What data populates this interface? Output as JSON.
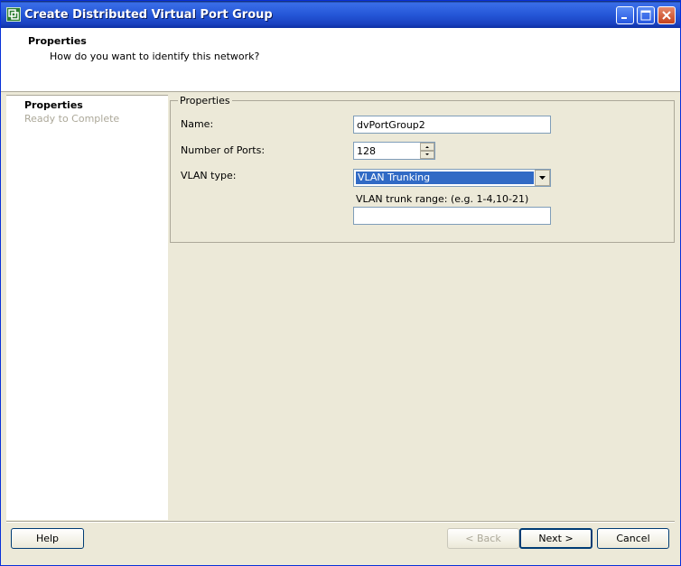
{
  "window": {
    "title": "Create Distributed Virtual Port Group"
  },
  "header": {
    "title": "Properties",
    "subtitle": "How do you want to identify this network?"
  },
  "steps": [
    {
      "label": "Properties",
      "state": "active"
    },
    {
      "label": "Ready to Complete",
      "state": "inactive"
    }
  ],
  "properties": {
    "legend": "Properties",
    "name_label": "Name:",
    "name_value": "dvPortGroup2",
    "ports_label": "Number of Ports:",
    "ports_value": "128",
    "vlan_label": "VLAN type:",
    "vlan_value": "VLAN Trunking",
    "trunk_label": "VLAN trunk range: (e.g. 1-4,10-21)",
    "trunk_value": ""
  },
  "buttons": {
    "help": "Help",
    "back": "< Back",
    "next": "Next >",
    "cancel": "Cancel"
  },
  "colors": {
    "titlebar": "#2557d8",
    "selection": "#316ac5",
    "dialog_bg": "#ece9d8"
  },
  "icons": {
    "app": "vmware-icon",
    "minimize": "minimize-icon",
    "maximize": "maximize-icon",
    "close": "close-icon",
    "dropdown": "chevron-down-icon"
  }
}
